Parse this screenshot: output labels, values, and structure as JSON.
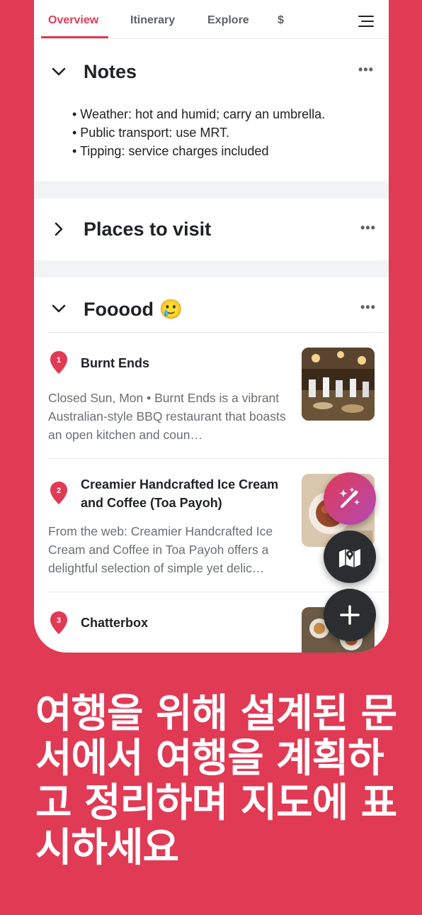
{
  "tabs": [
    {
      "label": "Overview",
      "active": true
    },
    {
      "label": "Itinerary"
    },
    {
      "label": "Explore"
    },
    {
      "label": "$"
    }
  ],
  "sections": {
    "notes": {
      "title": "Notes",
      "expanded": true,
      "items": [
        "• Weather: hot and humid; carry an umbrella.",
        "• Public transport: use MRT.",
        "• Tipping: service charges included"
      ]
    },
    "places": {
      "title": "Places to visit",
      "expanded": false
    },
    "food": {
      "title": "Fooood 🥲",
      "expanded": true,
      "places": [
        {
          "number": "1",
          "name": "Burnt Ends",
          "description": "Closed Sun, Mon • Burnt Ends is a vibrant Australian-style BBQ restaurant that boasts an open kitchen and coun…"
        },
        {
          "number": "2",
          "name": "Creamier Handcrafted Ice Cream and Coffee (Toa Payoh)",
          "description": "From the web: Creamier Handcrafted Ice Cream and Coffee in Toa Payoh offers a delightful selection of simple yet delic…"
        },
        {
          "number": "3",
          "name": "Chatterbox",
          "description": ""
        }
      ]
    }
  },
  "fabs": [
    {
      "icon": "magic-wand-icon"
    },
    {
      "icon": "map-icon"
    },
    {
      "icon": "plus-icon"
    }
  ],
  "headline": "여행을 위해 설계된 문서에서 여행을 계획하고 정리하며 지도에 표시하세요",
  "colors": {
    "accent": "#E03A55",
    "fab_dark": "#2b2d30"
  }
}
